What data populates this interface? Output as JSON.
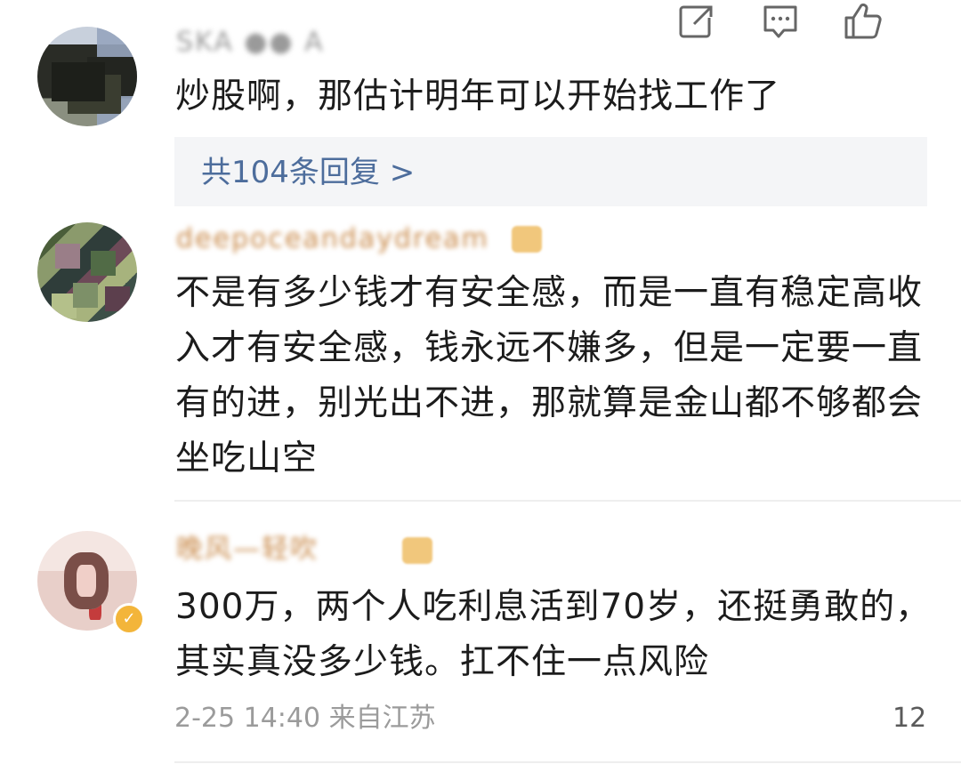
{
  "comments": [
    {
      "username": "SKA ●● A",
      "text": "炒股啊，那估计明年可以开始找工作了",
      "replies_label": "共104条回复 >"
    },
    {
      "username": "deepoceandaydream",
      "text": "不是有多少钱才有安全感，而是一直有稳定高收入才有安全感，钱永远不嫌多，但是一定要一直有的进，别光出不进，那就算是金山都不够都会坐吃山空"
    },
    {
      "username": "晚风—轻吹",
      "text": "300万，两个人吃利息活到70岁，还挺勇敢的，其实真没多少钱。扛不住一点风险",
      "timestamp": "2-25 14:40",
      "source": "来自江苏",
      "likes": "12"
    }
  ],
  "icons": {
    "share": "share-icon",
    "comment": "comment-icon",
    "like": "thumbs-up-icon",
    "verified": "verified-badge-icon"
  },
  "colors": {
    "link": "#4d6d9c",
    "meta": "#9b9b9b",
    "verified": "#f3b53a"
  }
}
